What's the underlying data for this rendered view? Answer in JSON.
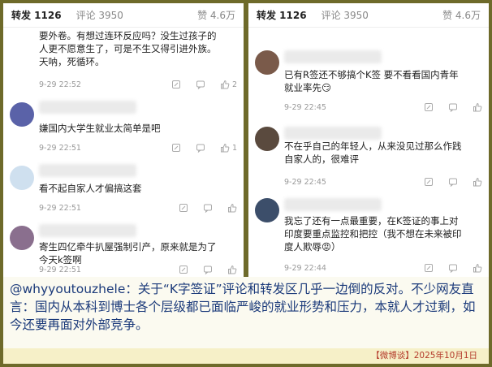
{
  "left_panel": {
    "tab_repost": "转发 1126",
    "tab_comments": "评论 3950",
    "likes": "赞 4.6万",
    "comments": [
      {
        "text": "要外卷。有想过连环反应吗？没生过孩子的\n人更不愿意生了，可是不生又得引进外族。\n天呐，死循环。",
        "time": "9-29 22:52",
        "likes": "2"
      },
      {
        "text": "嫌国内大学生就业太简单是吧",
        "time": "9-29 22:51",
        "likes": "1"
      },
      {
        "text": "看不起自家人才偏搞这套",
        "time": "9-29 22:51",
        "likes": ""
      },
      {
        "text": "寄生四亿牵牛扒屋强制引产，原来就是为了\n今天k签啊",
        "time": "9-29 22:51",
        "likes": ""
      }
    ]
  },
  "right_panel": {
    "tab_repost": "转发 1126",
    "tab_comments": "评论 3950",
    "likes": "赞 4.6万",
    "comments": [
      {
        "text": "已有R签还不够搞个K签 要不看看国内青年\n就业率先😏",
        "time": "9-29 22:45",
        "likes": ""
      },
      {
        "text": "不在乎自己的年轻人，从来没见过那么作践\n自家人的，很难评",
        "time": "9-29 22:45",
        "likes": ""
      },
      {
        "text": "我忘了还有一点最重要，在K签证的事上对\n印度要重点监控和把控（我不想在未来被印\n度人欺辱😡）",
        "time": "9-29 22:44",
        "likes": ""
      }
    ]
  },
  "caption": "@whyyoutouzhele：关于“K字签证”评论和转发区几乎一边倒的反对。不少网友直言：国内从本科到博士各个层级都已面临严峻的就业形势和压力，本就人才过剩，如今还要再面对外部竞争。",
  "footer": "【微博谈】2025年10月1日",
  "colors": {
    "frame": "#6e6a2a",
    "caption_text": "#1b3a7a",
    "footer_text": "#b43a2a",
    "footer_bg": "#f6f0c8"
  }
}
